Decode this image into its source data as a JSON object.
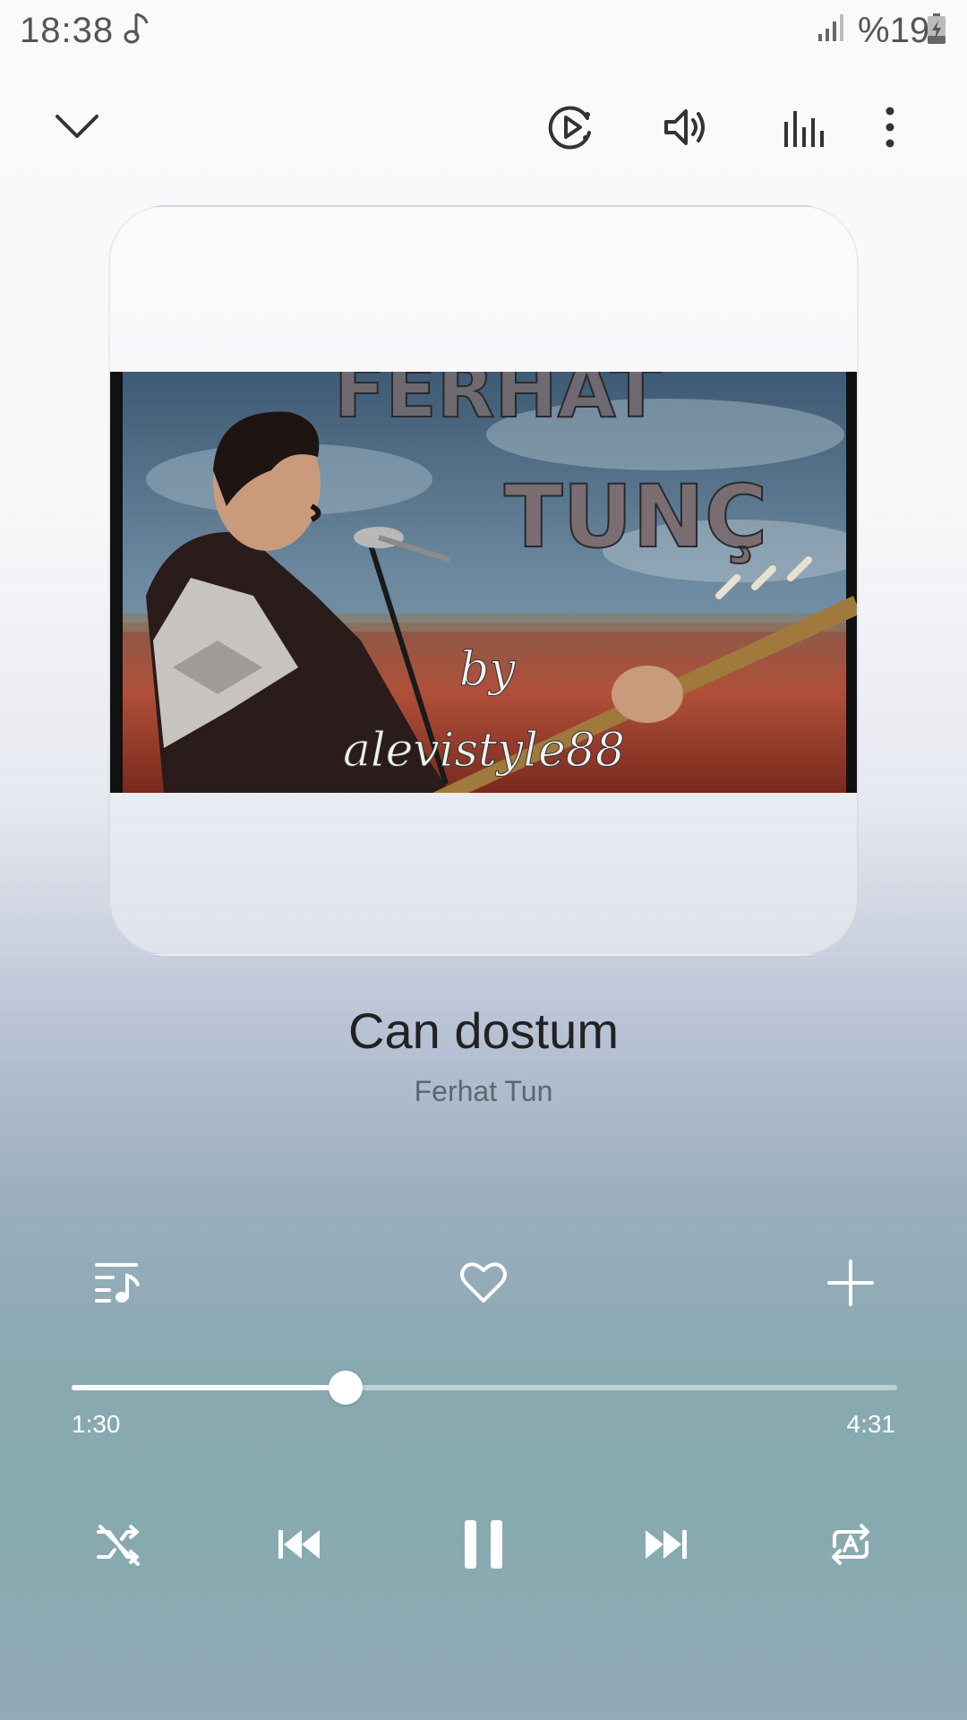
{
  "status_bar": {
    "time": "18:38",
    "battery": "%19"
  },
  "album": {
    "cover_title_line1": "FERHAT",
    "cover_title_line2": "TUNÇ",
    "cover_by": "by",
    "cover_credit": "alevistyle88"
  },
  "song": {
    "title": "Can dostum",
    "artist": "Ferhat Tun"
  },
  "playback": {
    "elapsed": "1:30",
    "duration": "4:31",
    "progress_fraction": 0.332
  },
  "colors": {
    "accent": "#ffffff",
    "text_primary": "#222222",
    "text_secondary": "#5d6670"
  },
  "icons": {
    "collapse": "chevron-down-icon",
    "smart_view": "smart-view-icon",
    "volume": "volume-icon",
    "equalizer": "equalizer-icon",
    "more": "more-options-icon",
    "queue": "playlist-queue-icon",
    "favorite": "heart-icon",
    "add": "add-icon",
    "shuffle": "shuffle-icon",
    "previous": "skip-previous-icon",
    "pause": "pause-icon",
    "next": "skip-next-icon",
    "repeat": "repeat-icon"
  }
}
